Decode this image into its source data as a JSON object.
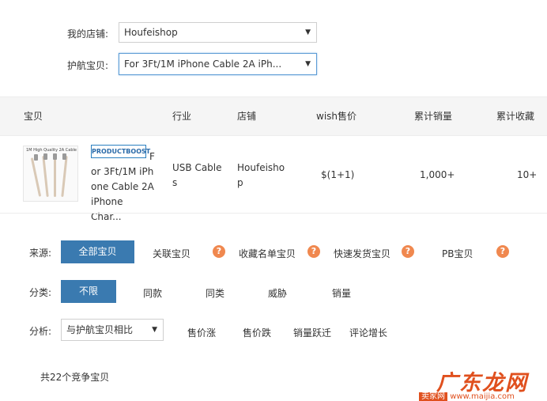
{
  "filters": {
    "shop_label": "我的店铺:",
    "shop_value": "Houfeishop",
    "product_label": "护航宝贝:",
    "product_value": "For 3Ft/1M iPhone Cable 2A iPh..."
  },
  "table": {
    "headers": [
      "宝贝",
      "行业",
      "店铺",
      "wish售价",
      "累计销量",
      "累计收藏"
    ],
    "row": {
      "thumb_text": "1M High Quality 2A Cable",
      "badge": "PRODUCTBOOST",
      "title_lines": [
        "F",
        "or 3Ft/1M iPh",
        "one Cable 2A",
        "iPhone Char..."
      ],
      "industry_lines": [
        "USB Cable",
        "s"
      ],
      "shop_lines": [
        "Houfeisho",
        "p"
      ],
      "price": "$(1+1)",
      "sales": "1,000+",
      "favorites": "10+"
    }
  },
  "source": {
    "label": "来源:",
    "options": [
      "全部宝贝",
      "关联宝贝",
      "收藏名单宝贝",
      "快速发货宝贝",
      "PB宝贝"
    ],
    "selected": "全部宝贝",
    "help_icon": "?"
  },
  "category": {
    "label": "分类:",
    "options": [
      "不限",
      "同款",
      "同类",
      "威胁",
      "销量"
    ],
    "selected": "不限"
  },
  "analysis": {
    "label": "分析:",
    "select_value": "与护航宝贝相比",
    "options": [
      "售价涨",
      "售价跌",
      "销量跃迁",
      "评论增长"
    ]
  },
  "summary": "共22个竞争宝贝",
  "watermark": {
    "main": "广东龙网",
    "sub_box": "卖家网",
    "sub_url": "www.maijia.com"
  },
  "colors": {
    "accent": "#3a7ab0",
    "help": "#f0884f",
    "header_bg": "#f5f5f5"
  }
}
